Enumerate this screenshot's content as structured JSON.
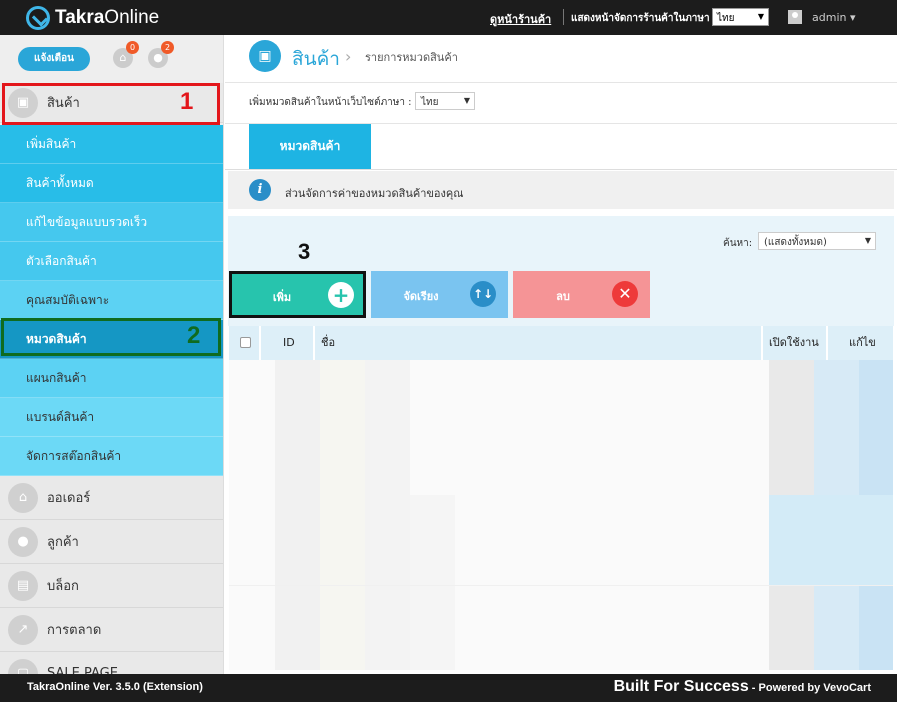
{
  "topbar": {
    "logo_bold": "Takra",
    "logo_light": "Online",
    "store_link": "ดูหน้าร้านค้า",
    "lang_label": "แสดงหน้าจัดการร้านค้าในภาษา",
    "lang_value": "ไทย",
    "admin": "admin ▾"
  },
  "sidebar": {
    "notify_btn": "แจ้งเตือน",
    "cart_badge": "0",
    "user_badge": "2",
    "products": "สินค้า",
    "sub_items": [
      "เพิ่มสินค้า",
      "สินค้าทั้งหมด",
      "แก้ไขข้อมูลแบบรวดเร็ว",
      "ตัวเลือกสินค้า",
      "คุณสมบัติเฉพาะ",
      "หมวดสินค้า",
      "แผนกสินค้า",
      "แบรนด์สินค้า",
      "จัดการสต๊อกสินค้า"
    ],
    "main_items": [
      "ออเดอร์",
      "ลูกค้า",
      "บล็อก",
      "การตลาด",
      "SALE PAGE"
    ]
  },
  "annotations": {
    "n1": "1",
    "n2": "2",
    "n3": "3"
  },
  "main": {
    "title": "สินค้า",
    "crumb": "รายการหมวดสินค้า",
    "lang_label": "เพิ่มหมวดสินค้าในหน้าเว็บไซต์ภาษา :",
    "lang_value": "ไทย",
    "tab": "หมวดสินค้า",
    "info": "ส่วนจัดการค่าของหมวดสินค้าของคุณ",
    "search_label": "ค้นหา:",
    "search_value": "(แสดงทั้งหมด)",
    "btn_add": "เพิ่ม",
    "btn_sort": "จัดเรียง",
    "btn_delete": "ลบ",
    "columns": {
      "id": "ID",
      "name": "ชื่อ",
      "enabled": "เปิดใช้งาน",
      "edit": "แก้ไข"
    }
  },
  "footer": {
    "version": "TakraOnline Ver. 3.5.0 (Extension)",
    "built": "Built For Success",
    "powered": " - Powered by VevoCart"
  },
  "colors": {
    "accent": "#2aa6d8",
    "add": "#27c4ad",
    "sort": "#7ac4f0",
    "delete": "#f59496"
  },
  "icons": [
    "box-icon",
    "basket-icon",
    "user-icon",
    "blog-icon",
    "chart-icon",
    "salepage-icon",
    "info-icon",
    "plus-icon",
    "sort-icon",
    "close-icon"
  ]
}
